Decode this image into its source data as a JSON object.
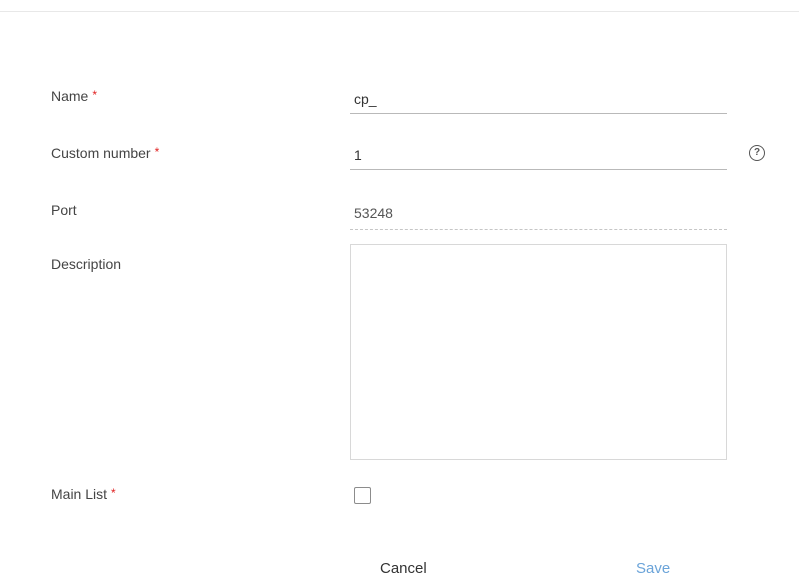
{
  "form": {
    "name": {
      "label": "Name",
      "required_mark": "*",
      "value": "cp_"
    },
    "custom_number": {
      "label": "Custom number",
      "required_mark": "*",
      "value": "1",
      "help_icon": "question-circle-icon",
      "help_glyph": "?"
    },
    "port": {
      "label": "Port",
      "value": "53248"
    },
    "description": {
      "label": "Description",
      "value": ""
    },
    "main_list": {
      "label": "Main List",
      "required_mark": "*",
      "checked": false
    }
  },
  "actions": {
    "cancel_label": "Cancel",
    "save_label": "Save"
  },
  "colors": {
    "required": "#e02020",
    "save": "#6ba4d9",
    "divider": "#e8e8e8"
  }
}
